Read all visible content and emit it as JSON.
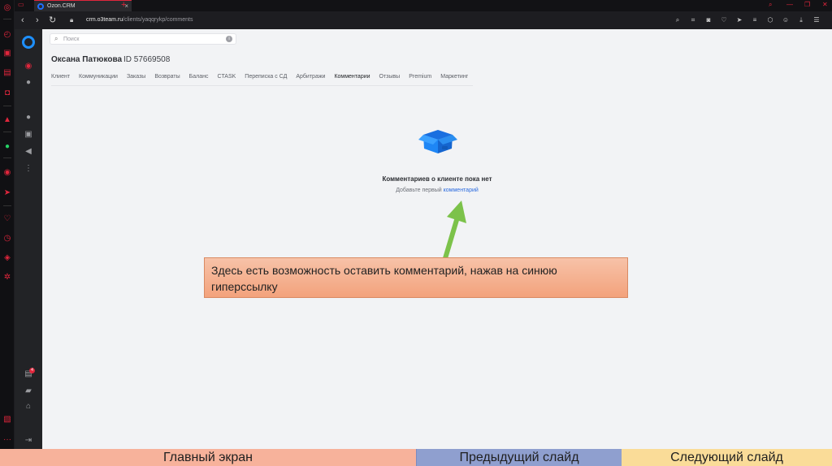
{
  "browser": {
    "tab_title": "Ozon.CRM",
    "url_host": "crm.o3team.ru",
    "url_path": "/clients/yaqqrykp/comments"
  },
  "search": {
    "placeholder": "Поиск"
  },
  "client": {
    "name": "Оксана Патюкова",
    "id_text": "ID 57669508"
  },
  "tabs": [
    {
      "label": "Клиент"
    },
    {
      "label": "Коммуникации"
    },
    {
      "label": "Заказы"
    },
    {
      "label": "Возвраты"
    },
    {
      "label": "Баланс"
    },
    {
      "label": "CTASK"
    },
    {
      "label": "Переписка с СД"
    },
    {
      "label": "Арбитражи"
    },
    {
      "label": "Комментарии",
      "active": true
    },
    {
      "label": "Отзывы"
    },
    {
      "label": "Premium"
    },
    {
      "label": "Маркетинг"
    }
  ],
  "empty_state": {
    "title": "Комментариев о клиенте пока нет",
    "subtitle_prefix": "Добавьте первый",
    "link_text": "комментарий"
  },
  "callout": {
    "text": "Здесь есть возможность оставить комментарий, нажав на синюю гиперссылку"
  },
  "rail": {
    "notification_count": "4"
  },
  "bottom_nav": {
    "home_label": "Главный экран",
    "prev_label": "Предыдущий слайд",
    "next_label": "Следующий слайд"
  },
  "colors": {
    "accent": "#2d6cdf",
    "callout_bg": "#f3a27c",
    "opera_red": "#e0263c",
    "arrow_green": "#7cc24a"
  },
  "icons": {
    "opera_sidebar": [
      "opera-logo-icon",
      "speed-dial-icon",
      "shopping-icon",
      "twitch-icon",
      "instagram-icon",
      "aria-icon",
      "whatsapp-icon",
      "player-icon",
      "send-icon",
      "heart-icon",
      "history-icon",
      "box-icon",
      "settings-icon",
      "gallery-icon",
      "more-icon"
    ],
    "rail": [
      "ozon-logo-icon",
      "record-icon",
      "play-icon",
      "user-icon",
      "check-icon",
      "megaphone-icon",
      "more-vertical-icon",
      "inbox-icon",
      "chat-icon",
      "home-icon",
      "logout-icon"
    ]
  }
}
